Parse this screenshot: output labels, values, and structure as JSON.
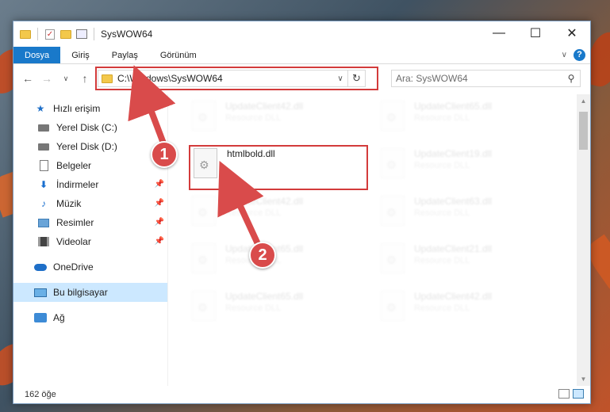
{
  "window": {
    "title": "SysWOW64",
    "controls": {
      "minimize": "—",
      "maximize": "☐",
      "close": "✕"
    }
  },
  "ribbon": {
    "tabs": [
      "Dosya",
      "Giriş",
      "Paylaş",
      "Görünüm"
    ],
    "active_tab": "Dosya",
    "collapse": "∨",
    "help": "?"
  },
  "nav": {
    "back": "←",
    "forward": "→",
    "recent": "∨",
    "up": "↑",
    "address": "C:\\Windows\\SysWOW64",
    "address_dropdown": "∨",
    "refresh": "↻",
    "search_placeholder": "Ara: SysWOW64",
    "search_icon": "⚲"
  },
  "sidebar": {
    "items": [
      {
        "label": "Hızlı erişim",
        "icon": "star-icon"
      },
      {
        "label": "Yerel Disk (C:)",
        "icon": "disk-icon",
        "pin": ""
      },
      {
        "label": "Yerel Disk (D:)",
        "icon": "disk-icon",
        "pin": ""
      },
      {
        "label": "Belgeler",
        "icon": "documents-icon",
        "pin": ""
      },
      {
        "label": "İndirmeler",
        "icon": "downloads-icon",
        "pin": "📌"
      },
      {
        "label": "Müzik",
        "icon": "music-icon",
        "pin": "📌"
      },
      {
        "label": "Resimler",
        "icon": "pictures-icon",
        "pin": "📌"
      },
      {
        "label": "Videolar",
        "icon": "videos-icon",
        "pin": "📌"
      },
      {
        "label": "OneDrive",
        "icon": "onedrive-icon"
      },
      {
        "label": "Bu bilgisayar",
        "icon": "this-pc-icon"
      },
      {
        "label": "Ağ",
        "icon": "network-icon"
      }
    ],
    "selected": "Bu bilgisayar"
  },
  "files": [
    {
      "name": "UpdateClient42.dll",
      "type": "Resource DLL"
    },
    {
      "name": "UpdateClient65.dll",
      "type": "Resource DLL"
    },
    {
      "name": "htmlbold.dll",
      "type": ""
    },
    {
      "name": "UpdateClient19.dll",
      "type": "Resource DLL"
    },
    {
      "name": "UpdateClient42.dll",
      "type": "Resource DLL"
    },
    {
      "name": "UpdateClient63.dll",
      "type": "Resource DLL"
    },
    {
      "name": "UpdateClient65.dll",
      "type": "Resource DLL"
    },
    {
      "name": "UpdateClient21.dll",
      "type": "Resource DLL"
    },
    {
      "name": "UpdateClient65.dll",
      "type": "Resource DLL"
    },
    {
      "name": "UpdateClient42.dll",
      "type": "Resource DLL"
    }
  ],
  "status": {
    "item_count": "162 öğe"
  },
  "annotations": {
    "step1": "1",
    "step2": "2",
    "color": "#d94b4b"
  }
}
